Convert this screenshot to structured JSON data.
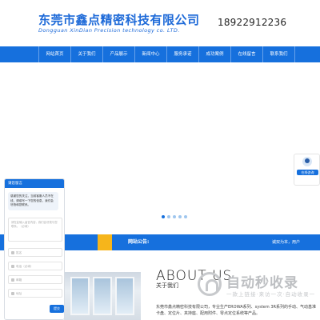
{
  "header": {
    "company_cn": "东莞市鑫点精密科技有限公司",
    "company_en": "Dongguan XinDian Precision technology co. LTD.",
    "phone": "18922912236"
  },
  "nav": {
    "items": [
      "网站首页",
      "关于我们",
      "产品展示",
      "新闻中心",
      "服务承诺",
      "成功案例",
      "在线留言",
      "联系我们"
    ]
  },
  "float_service": {
    "label": "在线咨询"
  },
  "notice": {
    "title": "网站公告:",
    "text": "诚双为本，用户"
  },
  "about": {
    "title": "ABOUT US",
    "subtitle": "关于我们",
    "text": "东莞市鑫点精密科技有限公司，专业生产EROWA系列、system 3R系列的手动、气动基准卡盘、定位片、夹持座、配用附件、零点定位系统等产品。"
  },
  "chat": {
    "header": "请您留言",
    "greeting": "感谢您的关注，当前客服人员不在线，请填写一下您的信息，我们会尽快和您联系。",
    "message_placeholder": "请在此输入留言内容，我们会尽快与您联系。（必填）",
    "fields": [
      "姓名",
      "电话（必填）",
      "邮箱",
      "地址"
    ],
    "send_label": "提交"
  },
  "watermark": {
    "main": "自动秒收录",
    "sub": "一款上链接·来访一次·自动收录一"
  },
  "colors": {
    "primary": "#1670dd",
    "accent": "#f6b51b",
    "brand_text": "#1e6ad8"
  }
}
